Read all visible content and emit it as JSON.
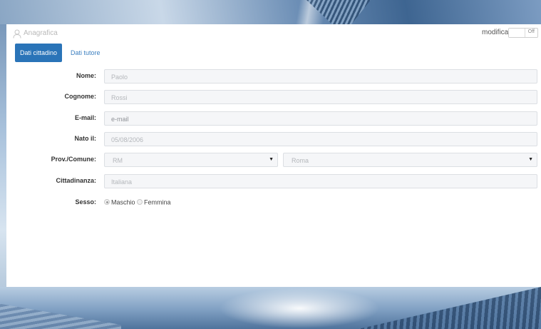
{
  "header": {
    "title": "Anagrafica",
    "toggle_label": "modifica",
    "toggle_state": "Off",
    "user_icon": "user-icon"
  },
  "tabs": [
    {
      "label": "Dati cittadino",
      "active": true
    },
    {
      "label": "Dati tutore",
      "active": false
    }
  ],
  "form": {
    "nome": {
      "label": "Nome:",
      "value": "Paolo"
    },
    "cognome": {
      "label": "Cognome:",
      "value": "Rossi"
    },
    "email": {
      "label": "E-mail:",
      "placeholder": "e-mail"
    },
    "nato_il": {
      "label": "Nato il:",
      "value": "05/08/2006"
    },
    "prov_comune": {
      "label": "Prov./Comune:",
      "prov": "RM",
      "comune": "Roma"
    },
    "cittadinanza": {
      "label": "Cittadinanza:",
      "value": "Italiana"
    },
    "sesso": {
      "label": "Sesso:",
      "options": [
        {
          "label": "Maschio",
          "checked": true
        },
        {
          "label": "Femmina",
          "checked": false
        }
      ]
    }
  },
  "colors": {
    "accent": "#2a74b8",
    "field_bg": "#f5f6f8",
    "field_border": "#dcdfe3"
  }
}
